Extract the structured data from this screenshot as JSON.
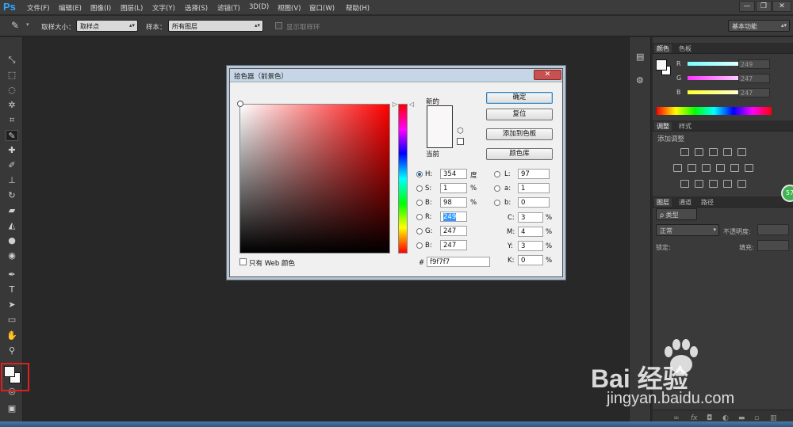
{
  "app": {
    "logo": "Ps"
  },
  "menubar": {
    "items": [
      "文件(F)",
      "编辑(E)",
      "图像(I)",
      "图层(L)",
      "文字(Y)",
      "选择(S)",
      "滤镜(T)",
      "3D(D)",
      "视图(V)",
      "窗口(W)",
      "帮助(H)"
    ]
  },
  "window_controls": {
    "minimize": "—",
    "restore": "❐",
    "close": "✕"
  },
  "options": {
    "sample_size_label": "取样大小：",
    "sample_size_value": "取样点",
    "sample_label": "样本：",
    "sample_value": "所有图层",
    "show_ring_label": "显示取样环",
    "workspace": "基本功能"
  },
  "color_panel": {
    "tabs": [
      "颜色",
      "色板"
    ],
    "rows": [
      {
        "label": "R",
        "value": "249"
      },
      {
        "label": "G",
        "value": "247"
      },
      {
        "label": "B",
        "value": "247"
      }
    ]
  },
  "adjust_panel": {
    "tabs": [
      "调整",
      "样式"
    ],
    "heading": "添加调整"
  },
  "layers_panel": {
    "tabs": [
      "图层",
      "通道",
      "路径"
    ],
    "filter_label": "ρ 类型",
    "blend_mode": "正常",
    "opacity_label": "不透明度:",
    "lock_label": "锁定:",
    "fill_label": "填充:"
  },
  "dialog": {
    "title": "拾色器（前景色）",
    "close": "✕",
    "new_label": "新的",
    "current_label": "当前",
    "buttons": {
      "ok": "确定",
      "reset": "复位",
      "add_swatch": "添加到色板",
      "library": "颜色库"
    },
    "hsb": [
      {
        "label": "H:",
        "value": "354",
        "unit": "度",
        "selected": true
      },
      {
        "label": "S:",
        "value": "1",
        "unit": "%",
        "selected": false
      },
      {
        "label": "B:",
        "value": "98",
        "unit": "%",
        "selected": false
      }
    ],
    "rgb": [
      {
        "label": "R:",
        "value": "249"
      },
      {
        "label": "G:",
        "value": "247"
      },
      {
        "label": "B:",
        "value": "247"
      }
    ],
    "lab": [
      {
        "label": "L:",
        "value": "97"
      },
      {
        "label": "a:",
        "value": "1"
      },
      {
        "label": "b:",
        "value": "0"
      }
    ],
    "cmyk": [
      {
        "label": "C:",
        "value": "3",
        "unit": "%"
      },
      {
        "label": "M:",
        "value": "4",
        "unit": "%"
      },
      {
        "label": "Y:",
        "value": "3",
        "unit": "%"
      },
      {
        "label": "K:",
        "value": "0",
        "unit": "%"
      }
    ],
    "hex_label": "#",
    "hex_value": "f9f7f7",
    "web_only_label": "只有 Web 颜色"
  },
  "colors": {
    "foreground": "#f9f7f7",
    "accent": "#31a8ff",
    "highlight_box": "#e02020"
  },
  "badge": "57",
  "watermark": {
    "logo": "Bai 经验",
    "url": "jingyan.baidu.com"
  }
}
